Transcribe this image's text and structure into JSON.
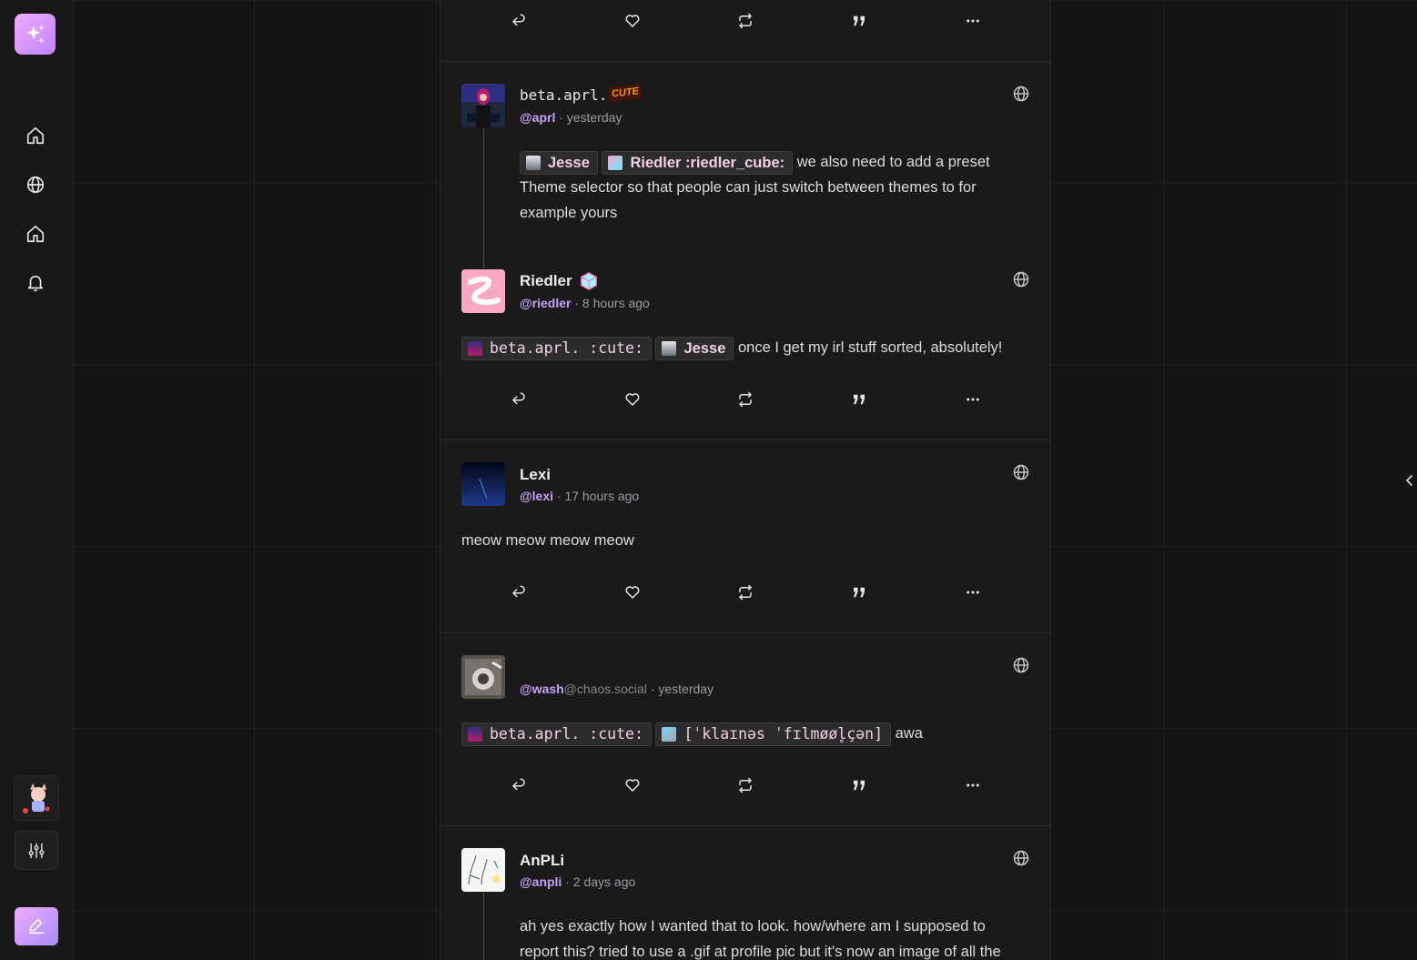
{
  "sidebar": {
    "nav": [
      {
        "icon": "home-icon"
      },
      {
        "icon": "globe-icon"
      },
      {
        "icon": "home-icon"
      },
      {
        "icon": "bell-icon"
      }
    ],
    "settings_icon": "sliders-icon",
    "compose_icon": "compose-icon"
  },
  "posts": [
    {
      "name": "beta.aprl.",
      "name_emoji": "CUTE",
      "handle": "@aprl",
      "time": "· yesterday",
      "mentions": [
        {
          "label": "Jesse"
        },
        {
          "label": "Riedler :riedler_cube:"
        }
      ],
      "text": "we also need to add a preset Theme selector so that people can just switch between themes to for example yours"
    },
    {
      "name": "Riedler",
      "handle": "@riedler",
      "time": "· 8 hours ago",
      "mentions": [
        {
          "label": "beta.aprl. :cute:"
        },
        {
          "label": "Jesse"
        }
      ],
      "text": "once I get my irl stuff sorted, absolutely!"
    },
    {
      "name": "Lexi",
      "handle": "@lexi",
      "time": "· 17 hours ago",
      "text": "meow meow meow meow"
    },
    {
      "name": "",
      "handle": "@wash",
      "server": "@chaos.social",
      "time": "· yesterday",
      "mentions": [
        {
          "label": "beta.aprl. :cute:"
        },
        {
          "label": "[ˈklaɪnəs ˈfɪlmøøl̥çən]"
        }
      ],
      "text": "awa"
    },
    {
      "name": "AnPLi",
      "handle": "@anpli",
      "time": "· 2 days ago",
      "text_line1": "ah yes exactly how I wanted that to look. how/where am I supposed to",
      "text_line2": "report this? tried to use a .gif at profile pic but it's now an image of all the"
    }
  ],
  "actions": [
    "reply-icon",
    "heart-icon",
    "repeat-icon",
    "quote-icon",
    "more-icon"
  ],
  "colors": {
    "accent": "#c4a2f5",
    "mention_text": "#f2d0e4",
    "background": "#101010",
    "column": "#1a1a1a"
  }
}
